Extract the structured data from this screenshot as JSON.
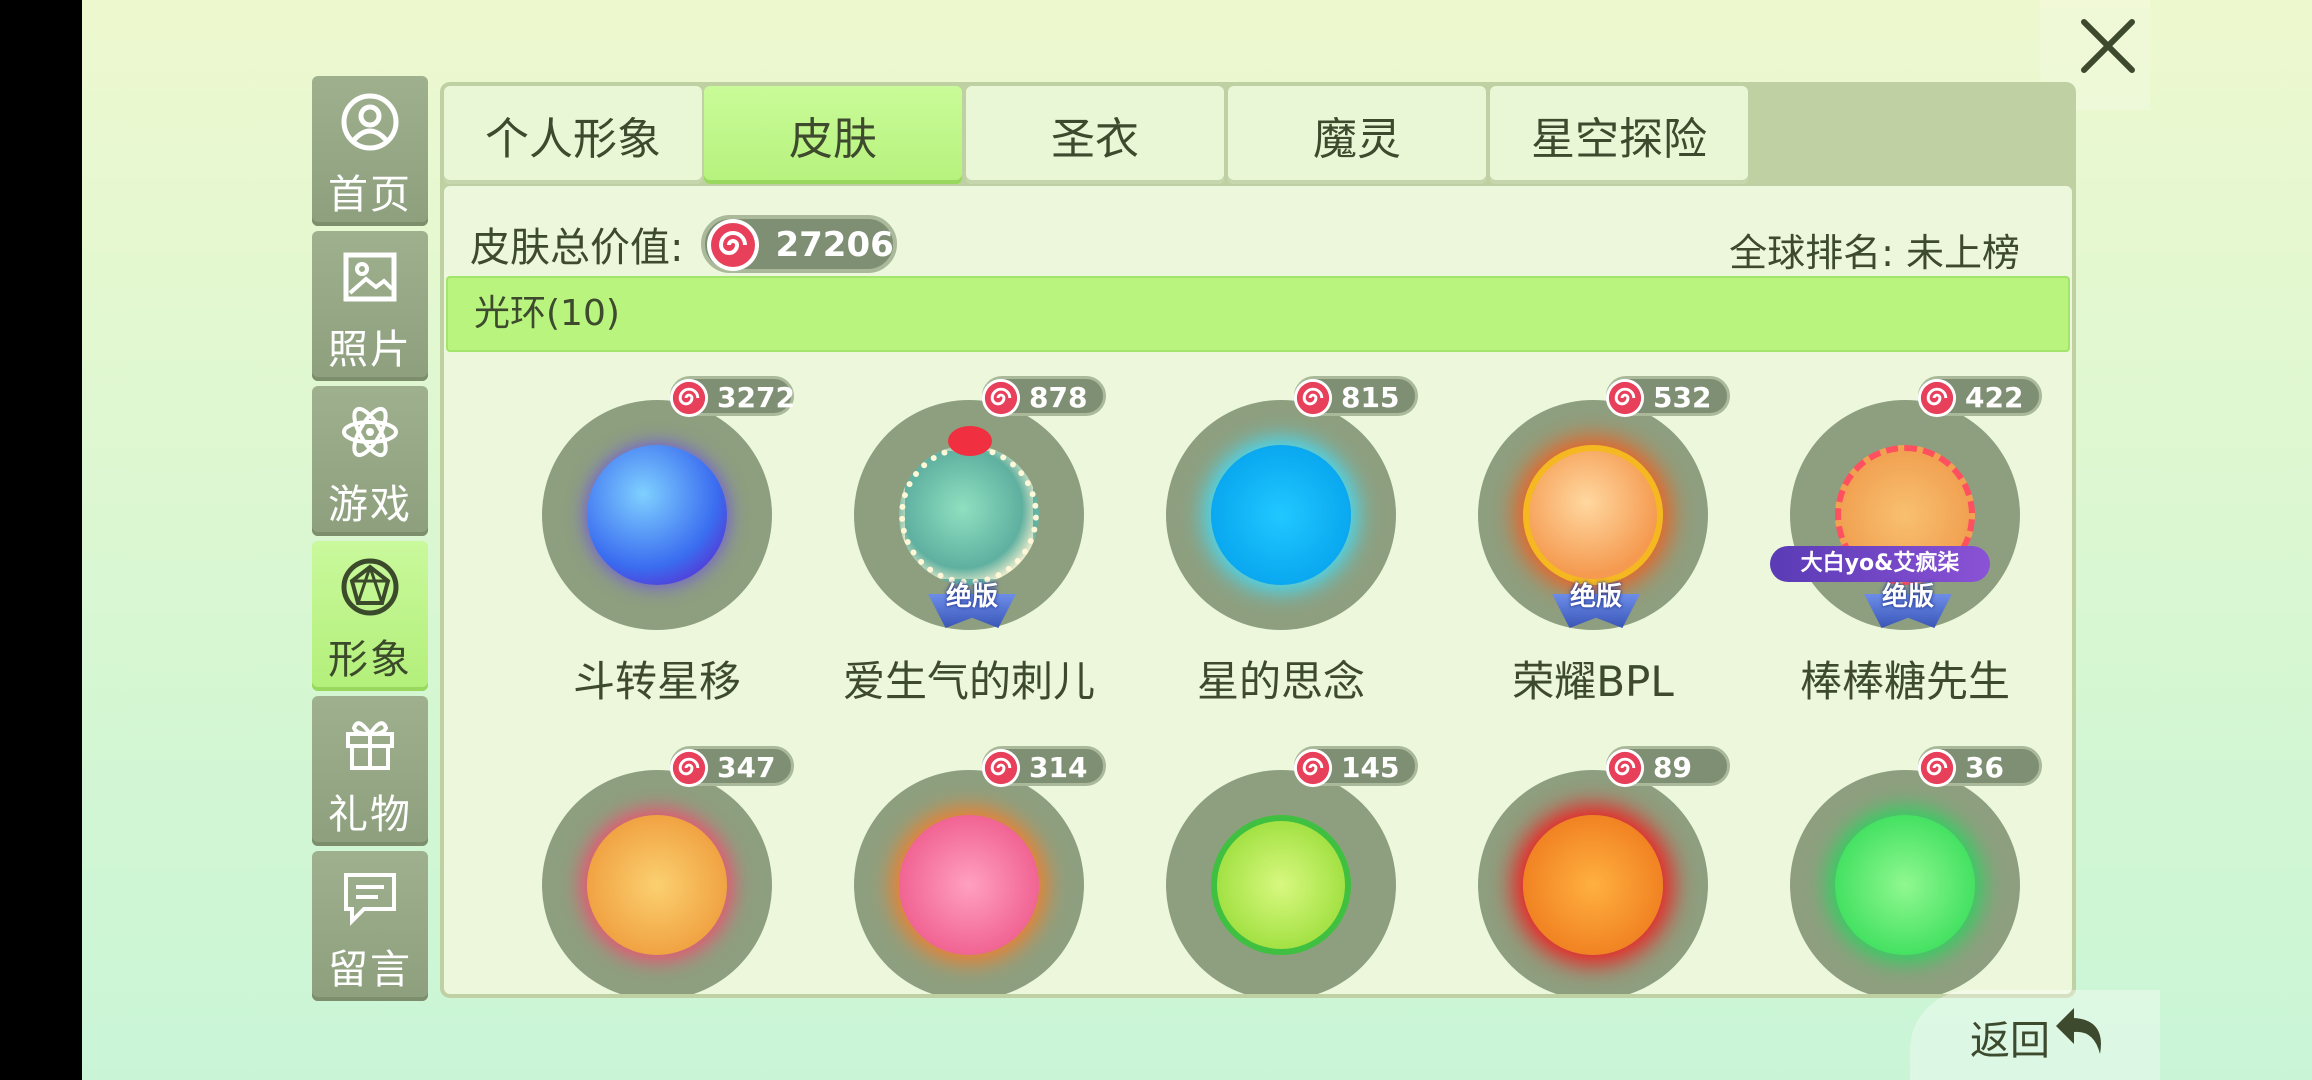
{
  "window": {
    "close_icon": "close-icon"
  },
  "sidebar": {
    "items": [
      {
        "label": "首页",
        "icon": "user-circle-icon",
        "active": false
      },
      {
        "label": "照片",
        "icon": "image-icon",
        "active": false
      },
      {
        "label": "游戏",
        "icon": "atom-icon",
        "active": false
      },
      {
        "label": "形象",
        "icon": "gem-icon",
        "active": true
      },
      {
        "label": "礼物",
        "icon": "gift-icon",
        "active": false
      },
      {
        "label": "留言",
        "icon": "message-icon",
        "active": false
      }
    ]
  },
  "tabs": [
    {
      "label": "个人形象",
      "active": false
    },
    {
      "label": "皮肤",
      "active": true
    },
    {
      "label": "圣衣",
      "active": false
    },
    {
      "label": "魔灵",
      "active": false
    },
    {
      "label": "星空探险",
      "active": false
    }
  ],
  "summary": {
    "value_label": "皮肤总价值:",
    "total_value": "27206",
    "rank_text": "全球排名: 未上榜"
  },
  "section": {
    "title": "光环(10)"
  },
  "items": [
    {
      "name": "斗转星移",
      "price": "3272",
      "badge": "",
      "collab": ""
    },
    {
      "name": "爱生气的刺儿",
      "price": "878",
      "badge": "绝版",
      "collab": ""
    },
    {
      "name": "星的思念",
      "price": "815",
      "badge": "",
      "collab": ""
    },
    {
      "name": "荣耀BPL",
      "price": "532",
      "badge": "绝版",
      "collab": ""
    },
    {
      "name": "棒棒糖先生",
      "price": "422",
      "badge": "绝版",
      "collab": "大白yo&艾疯柒"
    },
    {
      "name": "",
      "price": "347",
      "badge": "",
      "collab": ""
    },
    {
      "name": "",
      "price": "314",
      "badge": "",
      "collab": ""
    },
    {
      "name": "",
      "price": "145",
      "badge": "",
      "collab": ""
    },
    {
      "name": "",
      "price": "89",
      "badge": "",
      "collab": ""
    },
    {
      "name": "",
      "price": "36",
      "badge": "",
      "collab": ""
    }
  ],
  "footer": {
    "back_label": "返回",
    "back_icon": "return-arrow-icon"
  },
  "colors": {
    "accent_green": "#b8f47e",
    "candy_red": "#e8405a",
    "panel_bg": "#edf7dc"
  }
}
